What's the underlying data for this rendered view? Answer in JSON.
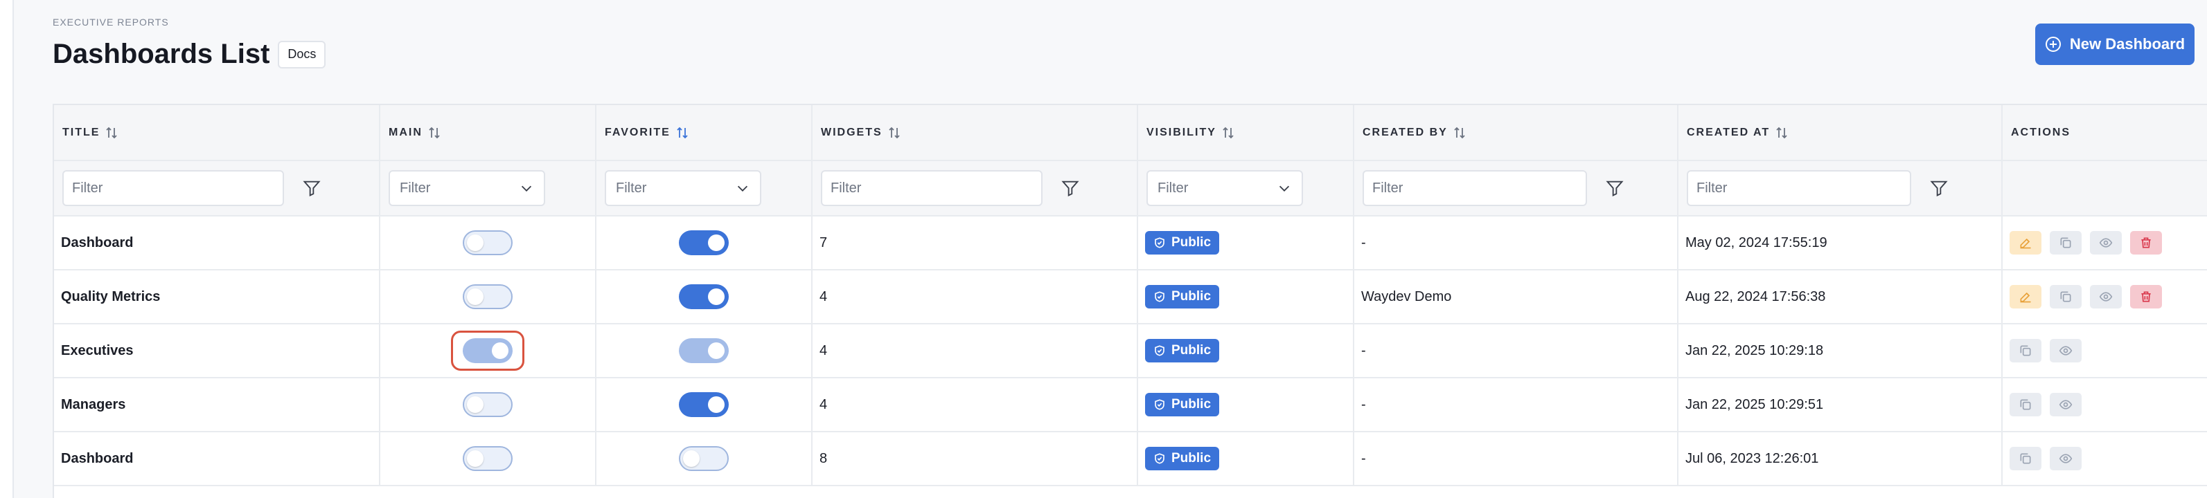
{
  "header": {
    "eyebrow": "EXECUTIVE REPORTS",
    "title": "Dashboards List",
    "docs_label": "Docs",
    "new_button_label": "New Dashboard"
  },
  "columns": [
    {
      "label": "TITLE",
      "sort": "both"
    },
    {
      "label": "MAIN",
      "sort": "both"
    },
    {
      "label": "FAVORITE",
      "sort": "desc-active"
    },
    {
      "label": "WIDGETS",
      "sort": "both"
    },
    {
      "label": "VISIBILITY",
      "sort": "both"
    },
    {
      "label": "CREATED BY",
      "sort": "both"
    },
    {
      "label": "CREATED AT",
      "sort": "both"
    },
    {
      "label": "ACTIONS",
      "sort": "none"
    }
  ],
  "filters": {
    "title": "Filter",
    "main": "Filter",
    "favorite": "Filter",
    "widgets": "Filter",
    "visibility": "Filter",
    "created_by": "Filter",
    "created_at": "Filter"
  },
  "rows": [
    {
      "title": "Dashboard",
      "main": false,
      "favorite": true,
      "widgets": "7",
      "visibility": "Public",
      "created_by": "-",
      "created_at": "May 02, 2024 17:55:19",
      "actions": [
        "edit",
        "copy",
        "view",
        "delete"
      ]
    },
    {
      "title": "Quality Metrics",
      "main": false,
      "favorite": true,
      "widgets": "4",
      "visibility": "Public",
      "created_by": "Waydev Demo",
      "created_at": "Aug 22, 2024 17:56:38",
      "actions": [
        "edit",
        "copy",
        "view",
        "delete"
      ]
    },
    {
      "title": "Executives",
      "main": true,
      "favorite": true,
      "widgets": "4",
      "visibility": "Public",
      "created_by": "-",
      "created_at": "Jan 22, 2025 10:29:18",
      "actions": [
        "copy",
        "view"
      ]
    },
    {
      "title": "Managers",
      "main": false,
      "favorite": true,
      "widgets": "4",
      "visibility": "Public",
      "created_by": "-",
      "created_at": "Jan 22, 2025 10:29:51",
      "actions": [
        "copy",
        "view"
      ]
    },
    {
      "title": "Dashboard",
      "main": false,
      "favorite": false,
      "widgets": "8",
      "visibility": "Public",
      "created_by": "-",
      "created_at": "Jul 06, 2023 12:26:01",
      "actions": [
        "copy",
        "view"
      ]
    }
  ],
  "colors": {
    "accent": "#3b73d8",
    "highlight": "#d9533f",
    "edit_bg": "#fde9c6",
    "delete_bg": "#f6c9cf"
  }
}
